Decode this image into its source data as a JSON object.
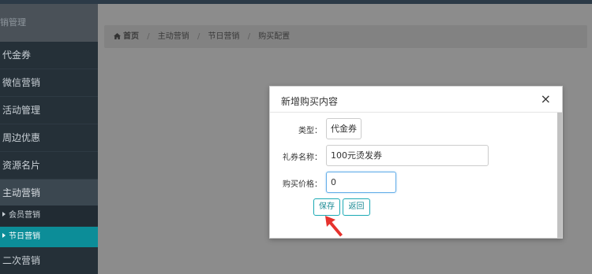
{
  "sidebar": {
    "header": "销管理",
    "items": [
      {
        "label": "代金券"
      },
      {
        "label": "微信营销"
      },
      {
        "label": "活动管理"
      },
      {
        "label": "周边优惠"
      },
      {
        "label": "资源名片"
      },
      {
        "label": "主动营销"
      }
    ],
    "subitems": [
      {
        "label": "会员营销",
        "active": false
      },
      {
        "label": "节日营销",
        "active": true
      }
    ],
    "after_item": "二次营销",
    "active_color": "#0c8d98"
  },
  "breadcrumb": {
    "home": "首页",
    "items": [
      "主动营销",
      "节日营销",
      "购买配置"
    ]
  },
  "modal": {
    "title": "新增购买内容",
    "close": "×",
    "type_label": "类型：",
    "type_value": "代金券",
    "name_label": "礼券名称：",
    "name_value": "100元烫发券",
    "price_label": "购买价格：",
    "price_value": "0",
    "save_label": "保存",
    "back_label": "返回"
  }
}
